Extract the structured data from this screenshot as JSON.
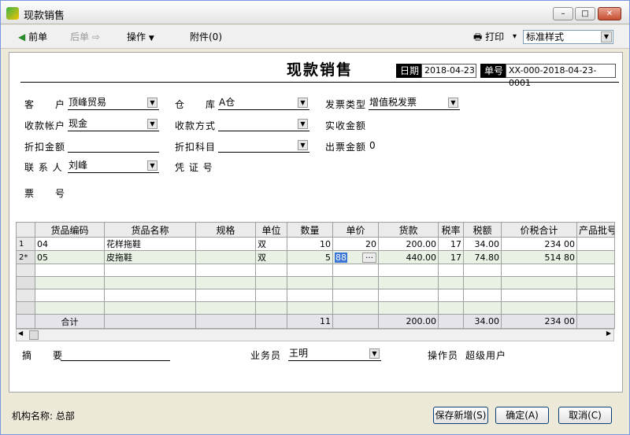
{
  "window": {
    "title": "现款销售",
    "minimize": "–",
    "maximize": "□",
    "close": "✕"
  },
  "toolbar": {
    "prev": "前单",
    "next": "后单",
    "ops": "操作",
    "attach": "附件(0)",
    "print": "打印",
    "print_arrow": "▾",
    "style": "标准样式"
  },
  "header": {
    "title": "现款销售",
    "date_label": "日期",
    "date_value": "2018-04-23",
    "docno_label": "单号",
    "docno_value": "XX-000-2018-04-23-0001",
    "customer_label": "客　　户",
    "customer_value": "顶峰贸易",
    "warehouse_label": "仓　　库",
    "warehouse_value": "A仓",
    "invoice_type_label": "发票类型",
    "invoice_type_value": "增值税发票",
    "account_label": "收款帐户",
    "account_value": "现金",
    "pay_method_label": "收款方式",
    "pay_method_value": "",
    "received_label": "实收金额",
    "discount_label": "折扣金额",
    "discount_value": "",
    "discount_subject_label": "折扣科目",
    "discount_subject_value": "",
    "invoiced_label": "出票金额",
    "invoiced_value": "0",
    "contact_label": "联 系 人",
    "contact_value": "刘峰",
    "voucher_label": "凭 证 号",
    "ticket_label": "票　　号"
  },
  "grid": {
    "columns": [
      "",
      "货品编码",
      "货品名称",
      "规格",
      "单位",
      "数量",
      "单价",
      "货款",
      "税率",
      "税额",
      "价税合计",
      "产品批号"
    ],
    "rows": [
      {
        "rh": "1",
        "code": "04",
        "name": "花样拖鞋",
        "spec": "",
        "unit": "双",
        "qty": "10",
        "price": "20",
        "amount": "200.00",
        "rate": "17",
        "tax": "34.00",
        "total": "234 00"
      },
      {
        "rh": "2*",
        "code": "05",
        "name": "皮拖鞋",
        "spec": "",
        "unit": "双",
        "qty": "5",
        "price": "88",
        "amount": "440.00",
        "rate": "17",
        "tax": "74.80",
        "total": "514 80"
      }
    ],
    "total_label": "合计",
    "total_qty": "11",
    "total_amount": "200.00",
    "total_tax": "34.00",
    "total_sum": "234 00"
  },
  "footer": {
    "memo_label": "摘　　要",
    "memo_value": "",
    "salesman_label": "业务员",
    "salesman_value": "王明",
    "operator_label": "操作员",
    "operator_value": "超级用户"
  },
  "bottom": {
    "org": "机构名称: 总部",
    "save_new": "保存新增(S)",
    "ok": "确定(A)",
    "cancel": "取消(C)"
  }
}
